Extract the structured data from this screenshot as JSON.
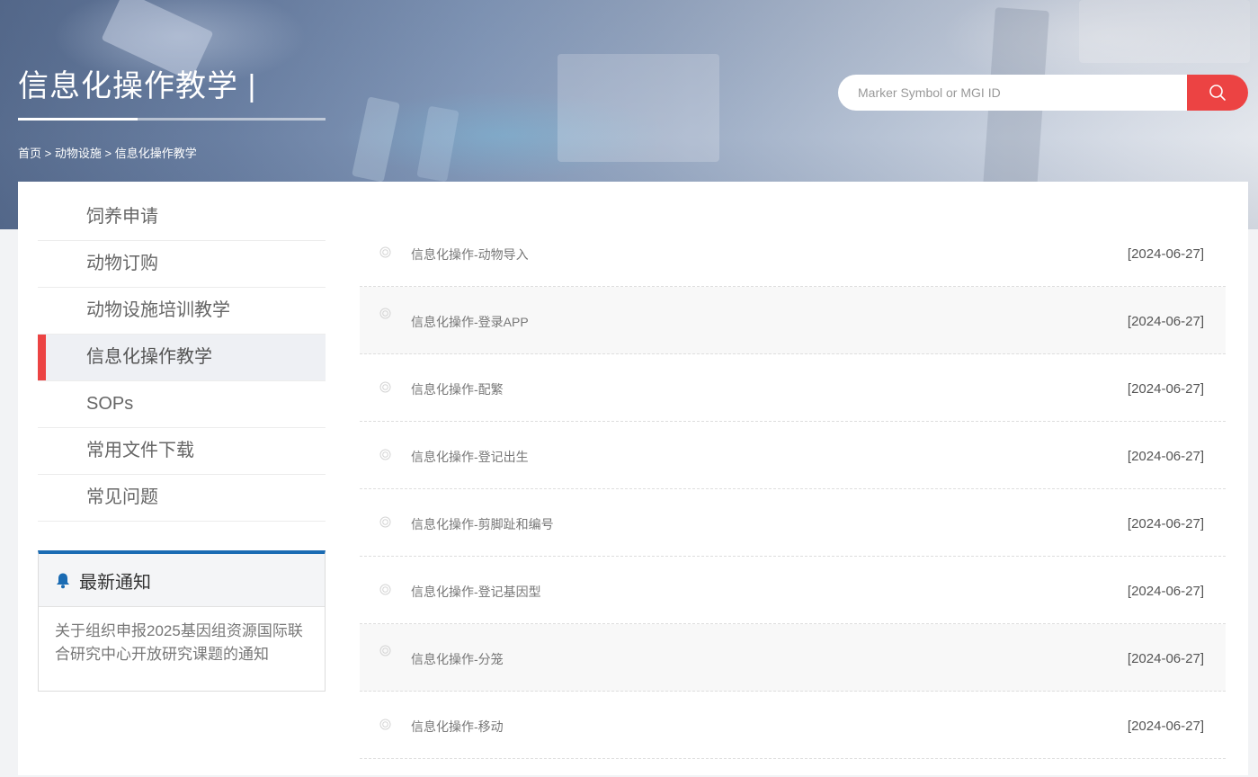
{
  "header": {
    "title": "信息化操作教学 |",
    "breadcrumb": [
      "首页",
      "动物设施",
      "信息化操作教学"
    ],
    "breadcrumb_sep": " > "
  },
  "search": {
    "placeholder": "Marker Symbol or MGI ID",
    "button_icon": "search-icon",
    "button_color": "#ec4343"
  },
  "sidebar": {
    "active_index": 3,
    "accent_color": "#ec4343",
    "items": [
      {
        "label": "饲养申请"
      },
      {
        "label": "动物订购"
      },
      {
        "label": "动物设施培训教学"
      },
      {
        "label": "信息化操作教学"
      },
      {
        "label": "SOPs"
      },
      {
        "label": "常用文件下载"
      },
      {
        "label": "常见问题"
      }
    ]
  },
  "notice": {
    "icon": "bell-icon",
    "title": "最新通知",
    "text": "关于组织申报2025基因组资源国际联合研究中心开放研究课题的通知",
    "border_color": "#1a6bb3"
  },
  "list": {
    "bullet_icon": "circle-bullet-icon",
    "items": [
      {
        "title": "信息化操作-动物导入",
        "date": "[2024-06-27]"
      },
      {
        "title": "信息化操作-登录APP",
        "date": "[2024-06-27]"
      },
      {
        "title": "信息化操作-配繁",
        "date": "[2024-06-27]"
      },
      {
        "title": "信息化操作-登记出生",
        "date": "[2024-06-27]"
      },
      {
        "title": "信息化操作-剪脚趾和编号",
        "date": "[2024-06-27]"
      },
      {
        "title": "信息化操作-登记基因型",
        "date": "[2024-06-27]"
      },
      {
        "title": "信息化操作-分笼",
        "date": "[2024-06-27]"
      },
      {
        "title": "信息化操作-移动",
        "date": "[2024-06-27]"
      }
    ]
  }
}
